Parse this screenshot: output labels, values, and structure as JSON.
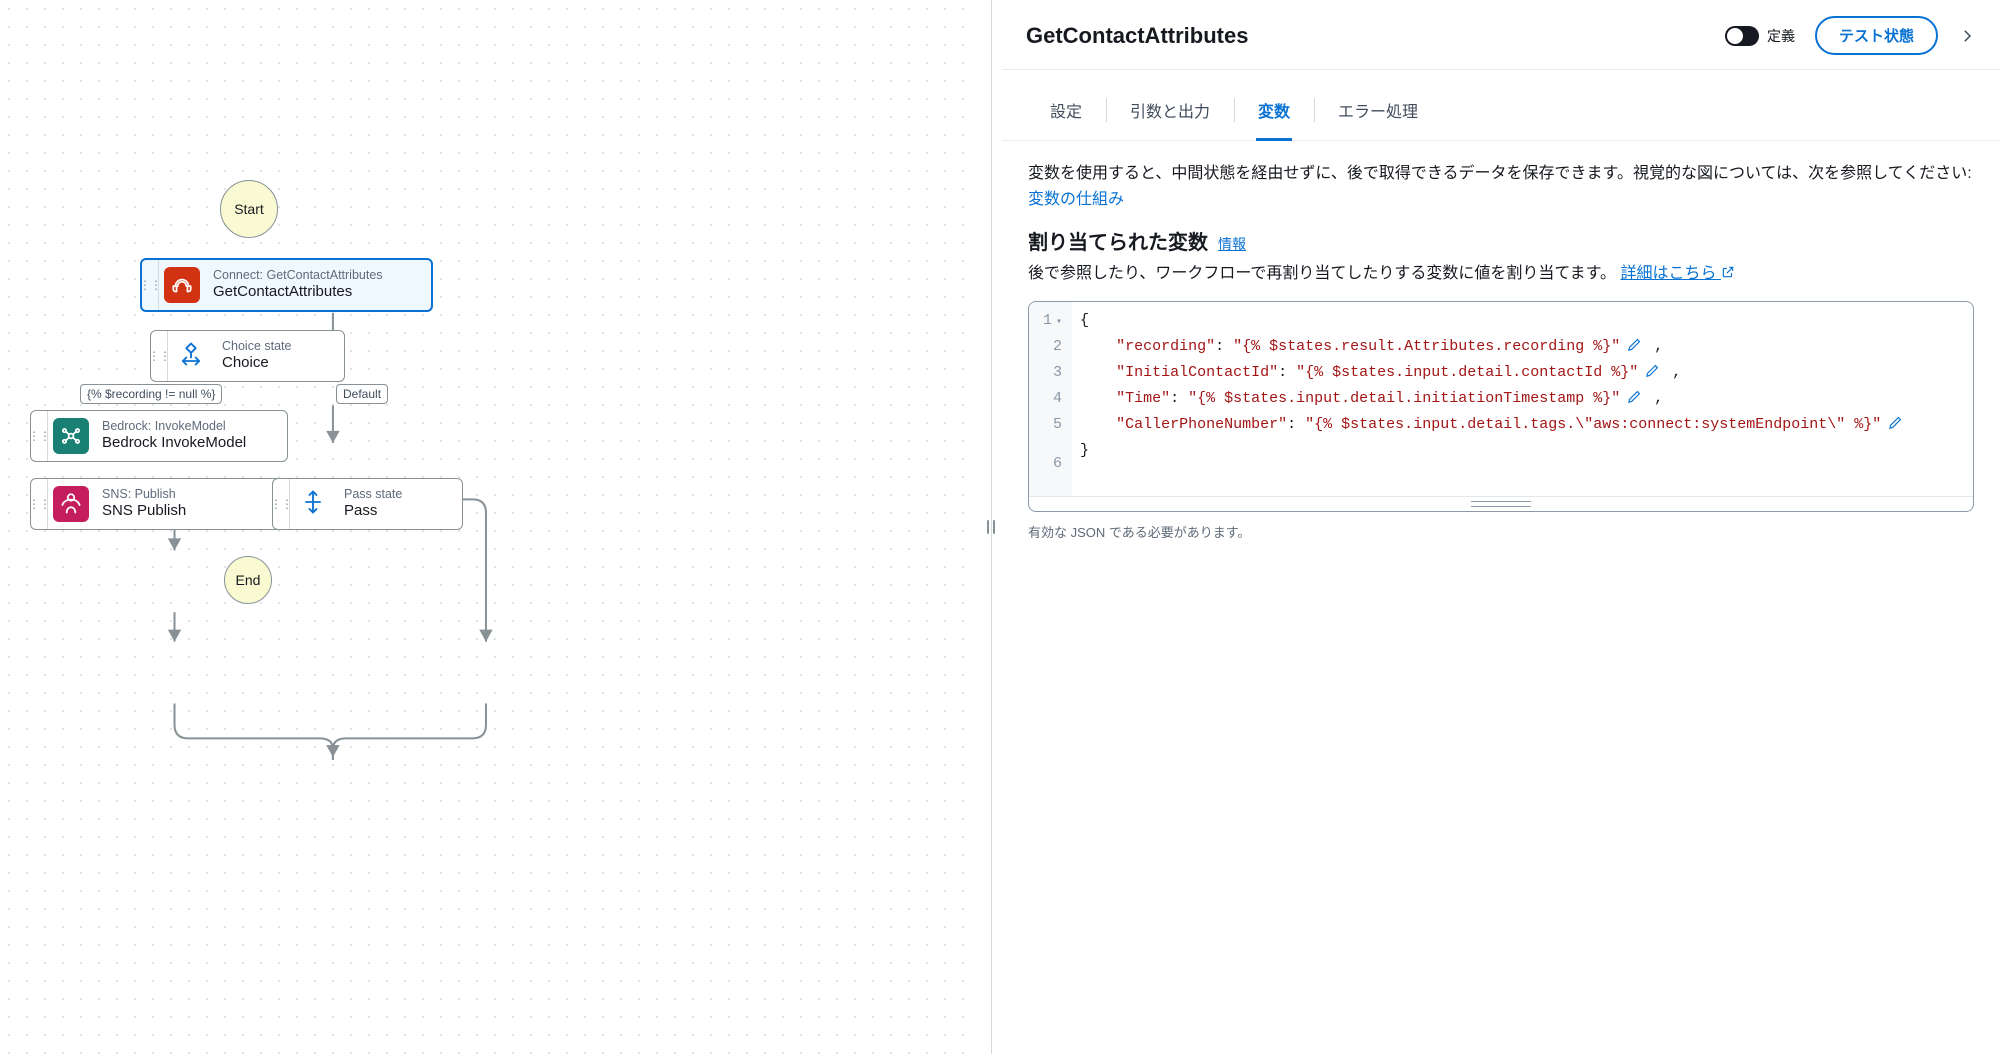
{
  "canvas": {
    "start_label": "Start",
    "end_label": "End",
    "edge_labels": {
      "choice_rule": "{% $recording != null %}",
      "choice_default": "Default"
    },
    "nodes": {
      "get_contact_attributes": {
        "subtitle": "Connect: GetContactAttributes",
        "title": "GetContactAttributes"
      },
      "choice": {
        "subtitle": "Choice state",
        "title": "Choice"
      },
      "bedrock": {
        "subtitle": "Bedrock: InvokeModel",
        "title": "Bedrock InvokeModel"
      },
      "sns": {
        "subtitle": "SNS: Publish",
        "title": "SNS Publish"
      },
      "pass": {
        "subtitle": "Pass state",
        "title": "Pass"
      }
    }
  },
  "panel": {
    "title": "GetContactAttributes",
    "toggle_label": "定義",
    "test_button": "テスト状態",
    "tabs": {
      "config": "設定",
      "io": "引数と出力",
      "vars": "変数",
      "errors": "エラー処理"
    },
    "active_tab": "vars",
    "desc_part1": "変数を使用すると、中間状態を経由せずに、後で取得できるデータを保存できます。視覚的な図については、次を参照してください: ",
    "desc_link": "変数の仕組み",
    "section_heading": "割り当てられた変数",
    "info_label": "情報",
    "assign_desc": "後で参照したり、ワークフローで再割り当てしたりする変数に値を割り当てます。 ",
    "learn_more": "詳細はこちら",
    "editor": {
      "keys": {
        "recording": "recording",
        "initialContactId": "InitialContactId",
        "time": "Time",
        "callerPhoneNumber": "CallerPhoneNumber"
      },
      "values": {
        "recording": "{% $states.result.Attributes.recording %}",
        "initialContactId": "{% $states.input.detail.contactId %}",
        "time": "{% $states.input.detail.initiationTimestamp %}",
        "callerPhoneNumber": "{% $states.input.detail.tags.\\\"aws:connect:systemEndpoint\\\" %}"
      }
    },
    "hint": "有効な JSON である必要があります。"
  }
}
